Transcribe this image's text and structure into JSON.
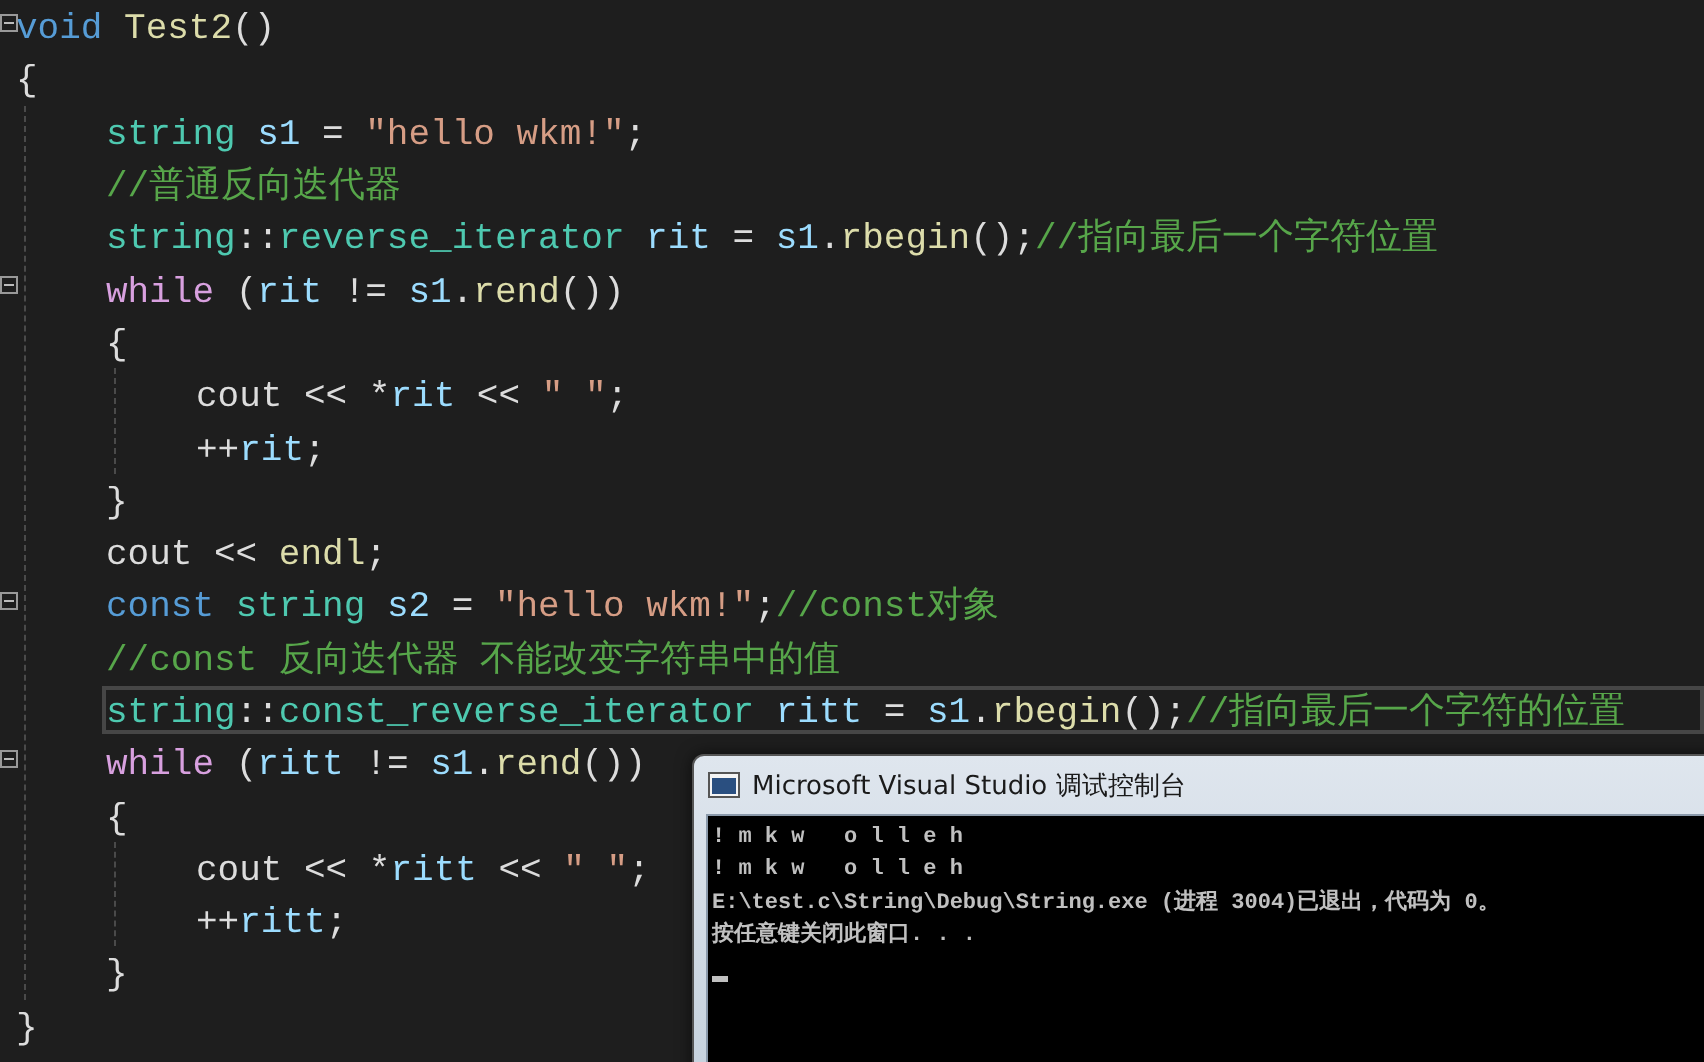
{
  "editor": {
    "lines": [
      {
        "fold": true,
        "current": false,
        "tokens": [
          {
            "kind": "keyword",
            "text": "void"
          },
          {
            "kind": "func",
            "text": " Test2"
          },
          {
            "kind": "plain",
            "text": "()"
          }
        ]
      },
      {
        "fold": false,
        "current": false,
        "tokens": [
          {
            "kind": "plain",
            "text": "{"
          }
        ],
        "children": [
          {
            "fold": false,
            "current": false,
            "tokens": [
              {
                "kind": "type",
                "text": "string"
              },
              {
                "kind": "var",
                "text": " s1"
              },
              {
                "kind": "plain",
                "text": " = "
              },
              {
                "kind": "string",
                "text": "\"hello wkm!\""
              },
              {
                "kind": "plain",
                "text": ";"
              }
            ]
          },
          {
            "fold": false,
            "current": false,
            "tokens": [
              {
                "kind": "comment",
                "text": "//普通反向迭代器"
              }
            ]
          },
          {
            "fold": false,
            "current": false,
            "tokens": [
              {
                "kind": "type",
                "text": "string"
              },
              {
                "kind": "plain",
                "text": "::"
              },
              {
                "kind": "type",
                "text": "reverse_iterator"
              },
              {
                "kind": "var",
                "text": " rit"
              },
              {
                "kind": "plain",
                "text": " = "
              },
              {
                "kind": "var",
                "text": "s1"
              },
              {
                "kind": "plain",
                "text": "."
              },
              {
                "kind": "func",
                "text": "rbegin"
              },
              {
                "kind": "plain",
                "text": "();"
              },
              {
                "kind": "comment",
                "text": "//指向最后一个字符位置"
              }
            ]
          },
          {
            "fold": true,
            "current": false,
            "tokens": [
              {
                "kind": "control",
                "text": "while"
              },
              {
                "kind": "plain",
                "text": " ("
              },
              {
                "kind": "var",
                "text": "rit"
              },
              {
                "kind": "plain",
                "text": " != "
              },
              {
                "kind": "var",
                "text": "s1"
              },
              {
                "kind": "plain",
                "text": "."
              },
              {
                "kind": "func",
                "text": "rend"
              },
              {
                "kind": "plain",
                "text": "())"
              }
            ]
          },
          {
            "fold": false,
            "current": false,
            "tokens": [
              {
                "kind": "plain",
                "text": "{"
              }
            ],
            "children": [
              {
                "fold": false,
                "current": false,
                "tokens": [
                  {
                    "kind": "plain",
                    "text": "cout << *"
                  },
                  {
                    "kind": "var",
                    "text": "rit"
                  },
                  {
                    "kind": "plain",
                    "text": " << "
                  },
                  {
                    "kind": "string",
                    "text": "\" \""
                  },
                  {
                    "kind": "plain",
                    "text": ";"
                  }
                ]
              },
              {
                "fold": false,
                "current": false,
                "tokens": [
                  {
                    "kind": "plain",
                    "text": "++"
                  },
                  {
                    "kind": "var",
                    "text": "rit"
                  },
                  {
                    "kind": "plain",
                    "text": ";"
                  }
                ]
              }
            ]
          },
          {
            "fold": false,
            "current": false,
            "tokens": [
              {
                "kind": "plain",
                "text": "}"
              }
            ]
          },
          {
            "fold": false,
            "current": false,
            "tokens": [
              {
                "kind": "plain",
                "text": "cout << "
              },
              {
                "kind": "func",
                "text": "endl"
              },
              {
                "kind": "plain",
                "text": ";"
              }
            ]
          },
          {
            "fold": true,
            "current": false,
            "tokens": [
              {
                "kind": "keyword",
                "text": "const"
              },
              {
                "kind": "type",
                "text": " string"
              },
              {
                "kind": "var",
                "text": " s2"
              },
              {
                "kind": "plain",
                "text": " = "
              },
              {
                "kind": "string",
                "text": "\"hello wkm!\""
              },
              {
                "kind": "plain",
                "text": ";"
              },
              {
                "kind": "comment",
                "text": "//const对象"
              }
            ]
          },
          {
            "fold": false,
            "current": false,
            "tokens": [
              {
                "kind": "comment",
                "text": "//const 反向迭代器 不能改变字符串中的值"
              }
            ]
          },
          {
            "fold": false,
            "current": true,
            "tokens": [
              {
                "kind": "type",
                "text": "string"
              },
              {
                "kind": "plain",
                "text": "::"
              },
              {
                "kind": "type",
                "text": "const_reverse_iterator"
              },
              {
                "kind": "var",
                "text": " ritt"
              },
              {
                "kind": "plain",
                "text": " = "
              },
              {
                "kind": "var",
                "text": "s1"
              },
              {
                "kind": "plain",
                "text": "."
              },
              {
                "kind": "func",
                "text": "rbegin"
              },
              {
                "kind": "plain",
                "text": "();"
              },
              {
                "kind": "comment",
                "text": "//指向最后一个字符的位置"
              }
            ]
          },
          {
            "fold": true,
            "current": false,
            "tokens": [
              {
                "kind": "control",
                "text": "while"
              },
              {
                "kind": "plain",
                "text": " ("
              },
              {
                "kind": "var",
                "text": "ritt"
              },
              {
                "kind": "plain",
                "text": " != "
              },
              {
                "kind": "var",
                "text": "s1"
              },
              {
                "kind": "plain",
                "text": "."
              },
              {
                "kind": "func",
                "text": "rend"
              },
              {
                "kind": "plain",
                "text": "())"
              }
            ]
          },
          {
            "fold": false,
            "current": false,
            "tokens": [
              {
                "kind": "plain",
                "text": "{"
              }
            ],
            "children": [
              {
                "fold": false,
                "current": false,
                "tokens": [
                  {
                    "kind": "plain",
                    "text": "cout << *"
                  },
                  {
                    "kind": "var",
                    "text": "ritt"
                  },
                  {
                    "kind": "plain",
                    "text": " << "
                  },
                  {
                    "kind": "string",
                    "text": "\" \""
                  },
                  {
                    "kind": "plain",
                    "text": ";"
                  }
                ]
              },
              {
                "fold": false,
                "current": false,
                "tokens": [
                  {
                    "kind": "plain",
                    "text": "++"
                  },
                  {
                    "kind": "var",
                    "text": "ritt"
                  },
                  {
                    "kind": "plain",
                    "text": ";"
                  }
                ]
              }
            ]
          },
          {
            "fold": false,
            "current": false,
            "tokens": [
              {
                "kind": "plain",
                "text": "}"
              }
            ]
          }
        ]
      },
      {
        "fold": false,
        "current": false,
        "tokens": [
          {
            "kind": "plain",
            "text": "}"
          }
        ]
      }
    ]
  },
  "console": {
    "title": "Microsoft Visual Studio 调试控制台",
    "lines": [
      "! m k w   o l l e h",
      "! m k w   o l l e h",
      "E:\\test.c\\String\\Debug\\String.exe (进程 3004)已退出，代码为 0。",
      "按任意键关闭此窗口. . ."
    ]
  }
}
